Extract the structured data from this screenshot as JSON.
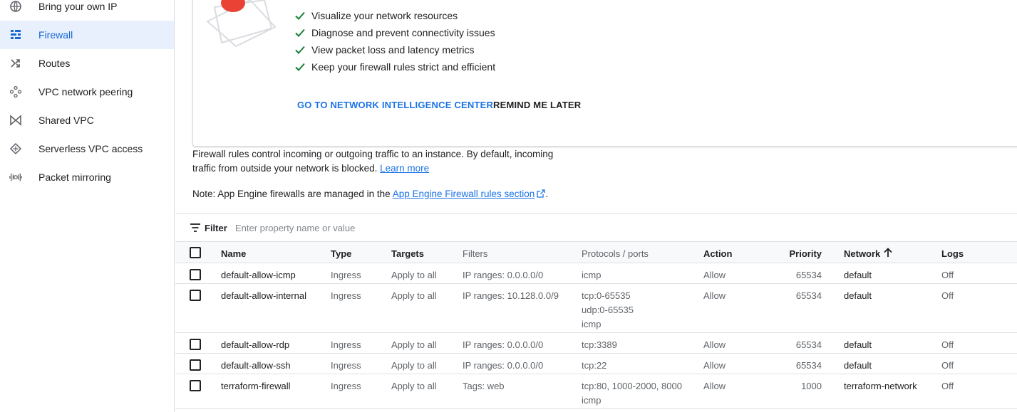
{
  "sidebar": {
    "items": [
      {
        "label": "Bring your own IP",
        "icon": "globe-icon",
        "active": false
      },
      {
        "label": "Firewall",
        "icon": "firewall-icon",
        "active": true
      },
      {
        "label": "Routes",
        "icon": "routes-icon",
        "active": false
      },
      {
        "label": "VPC network peering",
        "icon": "peering-icon",
        "active": false
      },
      {
        "label": "Shared VPC",
        "icon": "shared-vpc-icon",
        "active": false
      },
      {
        "label": "Serverless VPC access",
        "icon": "serverless-icon",
        "active": false
      },
      {
        "label": "Packet mirroring",
        "icon": "packet-mirroring-icon",
        "active": false
      }
    ]
  },
  "promo": {
    "checks": [
      "Visualize your network resources",
      "Diagnose and prevent connectivity issues",
      "View packet loss and latency metrics",
      "Keep your firewall rules strict and efficient"
    ],
    "primary_button": "GO TO NETWORK INTELLIGENCE CENTER",
    "secondary_button": "REMIND ME LATER"
  },
  "info": {
    "line1": "Firewall rules control incoming or outgoing traffic to an instance. By default, incoming",
    "line2": "traffic from outside your network is blocked.",
    "learn_more": "Learn more",
    "note_prefix": "Note: App Engine firewalls are managed in the",
    "note_link": "App Engine Firewall rules section",
    "note_suffix": "."
  },
  "filter": {
    "label": "Filter",
    "placeholder": "Enter property name or value"
  },
  "table": {
    "headers": {
      "name": "Name",
      "type": "Type",
      "targets": "Targets",
      "filters": "Filters",
      "protocols": "Protocols / ports",
      "action": "Action",
      "priority": "Priority",
      "network": "Network",
      "logs": "Logs"
    },
    "rows": [
      {
        "name": "default-allow-icmp",
        "type": "Ingress",
        "targets": "Apply to all",
        "filters": "IP ranges: 0.0.0.0/0",
        "protocols": [
          "icmp"
        ],
        "action": "Allow",
        "priority": "65534",
        "network": "default",
        "logs": "Off"
      },
      {
        "name": "default-allow-internal",
        "type": "Ingress",
        "targets": "Apply to all",
        "filters": "IP ranges: 10.128.0.0/9",
        "protocols": [
          "tcp:0-65535",
          "udp:0-65535",
          "icmp"
        ],
        "action": "Allow",
        "priority": "65534",
        "network": "default",
        "logs": "Off"
      },
      {
        "name": "default-allow-rdp",
        "type": "Ingress",
        "targets": "Apply to all",
        "filters": "IP ranges: 0.0.0.0/0",
        "protocols": [
          "tcp:3389"
        ],
        "action": "Allow",
        "priority": "65534",
        "network": "default",
        "logs": "Off"
      },
      {
        "name": "default-allow-ssh",
        "type": "Ingress",
        "targets": "Apply to all",
        "filters": "IP ranges: 0.0.0.0/0",
        "protocols": [
          "tcp:22"
        ],
        "action": "Allow",
        "priority": "65534",
        "network": "default",
        "logs": "Off"
      },
      {
        "name": "terraform-firewall",
        "type": "Ingress",
        "targets": "Apply to all",
        "filters": "Tags: web",
        "protocols": [
          "tcp:80, 1000-2000, 8000",
          "icmp"
        ],
        "action": "Allow",
        "priority": "1000",
        "network": "terraform-network",
        "logs": "Off"
      }
    ]
  },
  "colors": {
    "accent": "#1a73e8",
    "active_bg": "#e8f0fe",
    "check_green": "#188038",
    "illustration_red": "#ea4335"
  }
}
